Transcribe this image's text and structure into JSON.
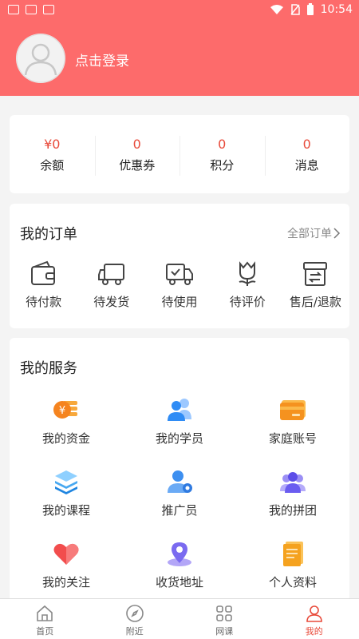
{
  "status_bar": {
    "time": "10:54"
  },
  "header": {
    "login_text": "点击登录"
  },
  "stats": [
    {
      "value": "¥0",
      "label": "余额"
    },
    {
      "value": "0",
      "label": "优惠券"
    },
    {
      "value": "0",
      "label": "积分"
    },
    {
      "value": "0",
      "label": "消息"
    }
  ],
  "orders": {
    "title": "我的订单",
    "all_label": "全部订单",
    "items": [
      {
        "label": "待付款",
        "icon": "wallet-icon"
      },
      {
        "label": "待发货",
        "icon": "truck-icon"
      },
      {
        "label": "待使用",
        "icon": "delivery-truck-icon"
      },
      {
        "label": "待评价",
        "icon": "flower-icon"
      },
      {
        "label": "售后/退款",
        "icon": "return-box-icon"
      }
    ]
  },
  "services": {
    "title": "我的服务",
    "items": [
      {
        "label": "我的资金",
        "icon": "coins-icon"
      },
      {
        "label": "我的学员",
        "icon": "students-icon"
      },
      {
        "label": "家庭账号",
        "icon": "card-icon"
      },
      {
        "label": "我的课程",
        "icon": "layers-icon"
      },
      {
        "label": "推广员",
        "icon": "promoter-icon"
      },
      {
        "label": "我的拼团",
        "icon": "group-icon"
      },
      {
        "label": "我的关注",
        "icon": "heart-icon"
      },
      {
        "label": "收货地址",
        "icon": "location-icon"
      },
      {
        "label": "个人资料",
        "icon": "document-icon"
      }
    ]
  },
  "tabbar": [
    {
      "label": "首页",
      "icon": "home-icon"
    },
    {
      "label": "附近",
      "icon": "compass-icon"
    },
    {
      "label": "网课",
      "icon": "grid-icon"
    },
    {
      "label": "我的",
      "icon": "user-icon"
    }
  ],
  "colors": {
    "primary": "#fd6b6b",
    "accent_text": "#e84a3a"
  }
}
